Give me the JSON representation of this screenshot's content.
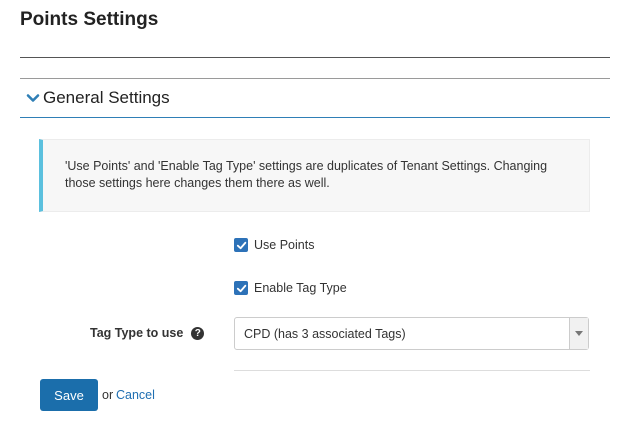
{
  "page": {
    "title": "Points Settings"
  },
  "section": {
    "title": "General Settings",
    "icon": "chevron-down-icon"
  },
  "info": {
    "text": "'Use Points' and 'Enable Tag Type' settings are duplicates of Tenant Settings. Changing those settings here changes them there as well."
  },
  "form": {
    "use_points": {
      "label": "Use Points",
      "checked": true
    },
    "enable_tag_type": {
      "label": "Enable Tag Type",
      "checked": true
    },
    "tag_type": {
      "label": "Tag Type to use",
      "help_icon": "question-circle-icon",
      "selected": "CPD (has 3 associated Tags)"
    }
  },
  "actions": {
    "save_label": "Save",
    "or_text": "or",
    "cancel_label": "Cancel"
  },
  "colors": {
    "primary": "#1b6eab",
    "info_accent": "#5bc0de",
    "checkbox": "#2d72b8",
    "link": "#1f6fb2"
  }
}
